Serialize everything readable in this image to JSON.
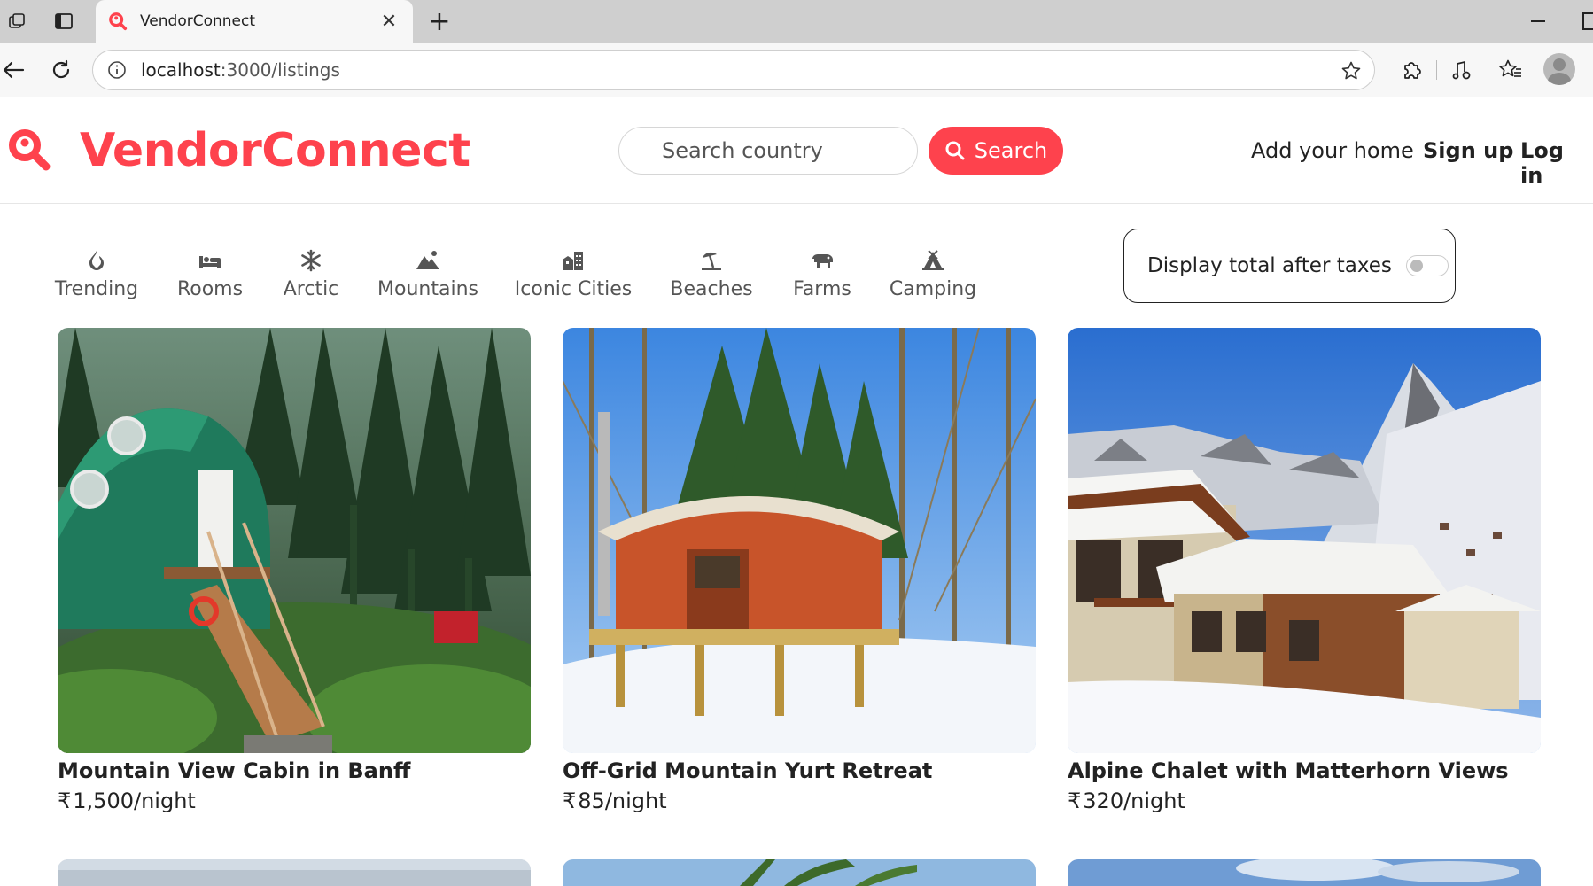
{
  "browser": {
    "tab_title": "VendorConnect",
    "url_host": "localhost",
    "url_path": ":3000/listings"
  },
  "site": {
    "brand": "VendorConnect",
    "search_placeholder": "Search country",
    "search_button": "Search",
    "nav": {
      "add_home": "Add your home",
      "signup": "Sign up",
      "login": "Log in"
    },
    "brand_color": "#fe424d"
  },
  "filters": [
    {
      "label": "Trending",
      "icon": "fire-icon"
    },
    {
      "label": "Rooms",
      "icon": "bed-icon"
    },
    {
      "label": "Arctic",
      "icon": "snowflake-icon"
    },
    {
      "label": "Mountains",
      "icon": "mountain-icon"
    },
    {
      "label": "Iconic Cities",
      "icon": "city-icon"
    },
    {
      "label": "Beaches",
      "icon": "umbrella-beach-icon"
    },
    {
      "label": "Farms",
      "icon": "cow-icon"
    },
    {
      "label": "Camping",
      "icon": "campground-icon"
    }
  ],
  "tax_toggle": {
    "label": "Display total after taxes",
    "on": false
  },
  "listings": [
    {
      "title": "Mountain View Cabin in Banff",
      "currency": "₹",
      "price": "1,500",
      "per": "/night"
    },
    {
      "title": "Off-Grid Mountain Yurt Retreat",
      "currency": "₹",
      "price": "85",
      "per": "/night"
    },
    {
      "title": "Alpine Chalet with Matterhorn Views",
      "currency": "₹",
      "price": "320",
      "per": "/night"
    }
  ]
}
